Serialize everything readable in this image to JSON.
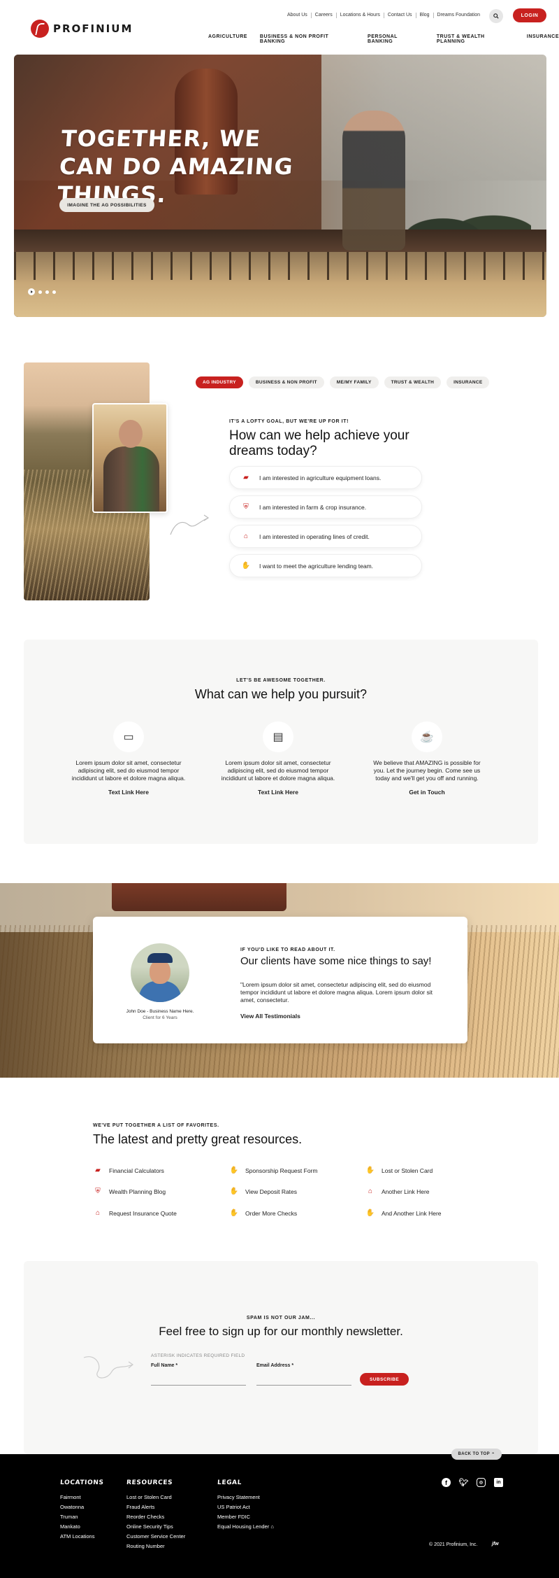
{
  "brand": {
    "name": "PROFINIUM",
    "accent": "#c8211f"
  },
  "utility_nav": [
    "About Us",
    "Careers",
    "Locations & Hours",
    "Contact Us",
    "Blog",
    "Dreams Foundation"
  ],
  "login_label": "LOGIN",
  "main_nav": [
    "AGRICULTURE",
    "BUSINESS & NON PROFIT BANKING",
    "PERSONAL BANKING",
    "TRUST & WEALTH PLANNING",
    "INSURANCE"
  ],
  "hero": {
    "title": "TOGETHER, WE CAN DO AMAZING THINGS.",
    "cta": "IMAGINE THE AG POSSIBILITIES",
    "slide_count": 3,
    "active_slide": 1
  },
  "help": {
    "tabs": [
      "AG INDUSTRY",
      "BUSINESS & NON PROFIT",
      "ME/MY FAMILY",
      "TRUST & WEALTH",
      "INSURANCE"
    ],
    "active_tab": "AG INDUSTRY",
    "eyebrow": "IT'S A LOFTY GOAL, BUT WE'RE UP FOR IT!",
    "title": "How can we help achieve your dreams today?",
    "items": [
      {
        "icon": "tractor-icon",
        "label": "I am interested in agriculture equipment loans."
      },
      {
        "icon": "crop-insurance-icon",
        "label": "I am interested in farm & crop insurance."
      },
      {
        "icon": "barn-icon",
        "label": "I am interested in operating lines of credit."
      },
      {
        "icon": "handshake-icon",
        "label": "I want to meet the agriculture lending team."
      }
    ]
  },
  "pursuit": {
    "eyebrow": "LET'S BE AWESOME TOGETHER.",
    "title": "What can we help you pursuit?",
    "columns": [
      {
        "icon": "computer-money-icon",
        "text": "Lorem ipsum dolor sit amet, consectetur adipiscing elit, sed do eiusmod tempor incididunt ut labore et dolore magna aliqua.",
        "link": "Text Link Here"
      },
      {
        "icon": "card-icon",
        "text": "Lorem ipsum dolor sit amet, consectetur adipiscing elit, sed do eiusmod tempor incididunt ut labore et dolore magna aliqua.",
        "link": "Text Link Here"
      },
      {
        "icon": "coffee-icon",
        "text": "We believe that AMAZING is possible for you. Let the journey begin. Come see us today and we'll get you off and running.",
        "link": "Get in Touch"
      }
    ]
  },
  "testimonial": {
    "name": "John Doe - Business Name Here.",
    "since": "Client for 6 Years",
    "eyebrow": "IF YOU'D LIKE TO READ ABOUT IT.",
    "title": "Our clients have some nice things to say!",
    "quote": "\"Lorem ipsum dolor sit amet, consectetur adipiscing elit, sed do eiusmod tempor incididunt ut labore et dolore magna aliqua. Lorem ipsum dolor sit amet, consectetur.",
    "link": "View All Testimonials"
  },
  "resources": {
    "eyebrow": "WE'VE PUT TOGETHER A LIST OF FAVORITES.",
    "title": "The latest and pretty great resources.",
    "items": [
      {
        "icon": "tractor-icon",
        "label": "Financial Calculators"
      },
      {
        "icon": "handshake-icon",
        "label": "Sponsorship Request Form"
      },
      {
        "icon": "handshake-icon",
        "label": "Lost or Stolen Card"
      },
      {
        "icon": "crop-insurance-icon",
        "label": "Wealth Planning Blog"
      },
      {
        "icon": "handshake-icon",
        "label": "View Deposit Rates"
      },
      {
        "icon": "barn-icon",
        "label": "Another Link Here"
      },
      {
        "icon": "barn-icon",
        "label": "Request Insurance Quote"
      },
      {
        "icon": "handshake-icon",
        "label": "Order More Checks"
      },
      {
        "icon": "handshake-icon",
        "label": "And Another Link Here"
      }
    ]
  },
  "newsletter": {
    "eyebrow": "SPAM IS NOT OUR JAM...",
    "title": "Feel free to sign up for our monthly newsletter.",
    "note": "ASTERISK INDICATES REQUIRED FIELD",
    "full_name_label": "Full Name *",
    "email_label": "Email Address *",
    "button": "SUBSCRIBE"
  },
  "footer": {
    "back_to_top": "BACK TO TOP",
    "locations_title": "Locations",
    "locations": [
      "Fairmont",
      "Owatonna",
      "Truman",
      "Mankato",
      "ATM Locations"
    ],
    "resources_title": "Resources",
    "resources": [
      "Lost or Stolen Card",
      "Fraud Alerts",
      "Reorder Checks",
      "Online Security Tips",
      "Customer Service Center",
      "Routing Number"
    ],
    "legal_title": "Legal",
    "legal": [
      "Privacy Statement",
      "US Patriot Act",
      "Member FDIC",
      "Equal Housing Lender"
    ],
    "copyright": "© 2021 Profinium, Inc."
  }
}
